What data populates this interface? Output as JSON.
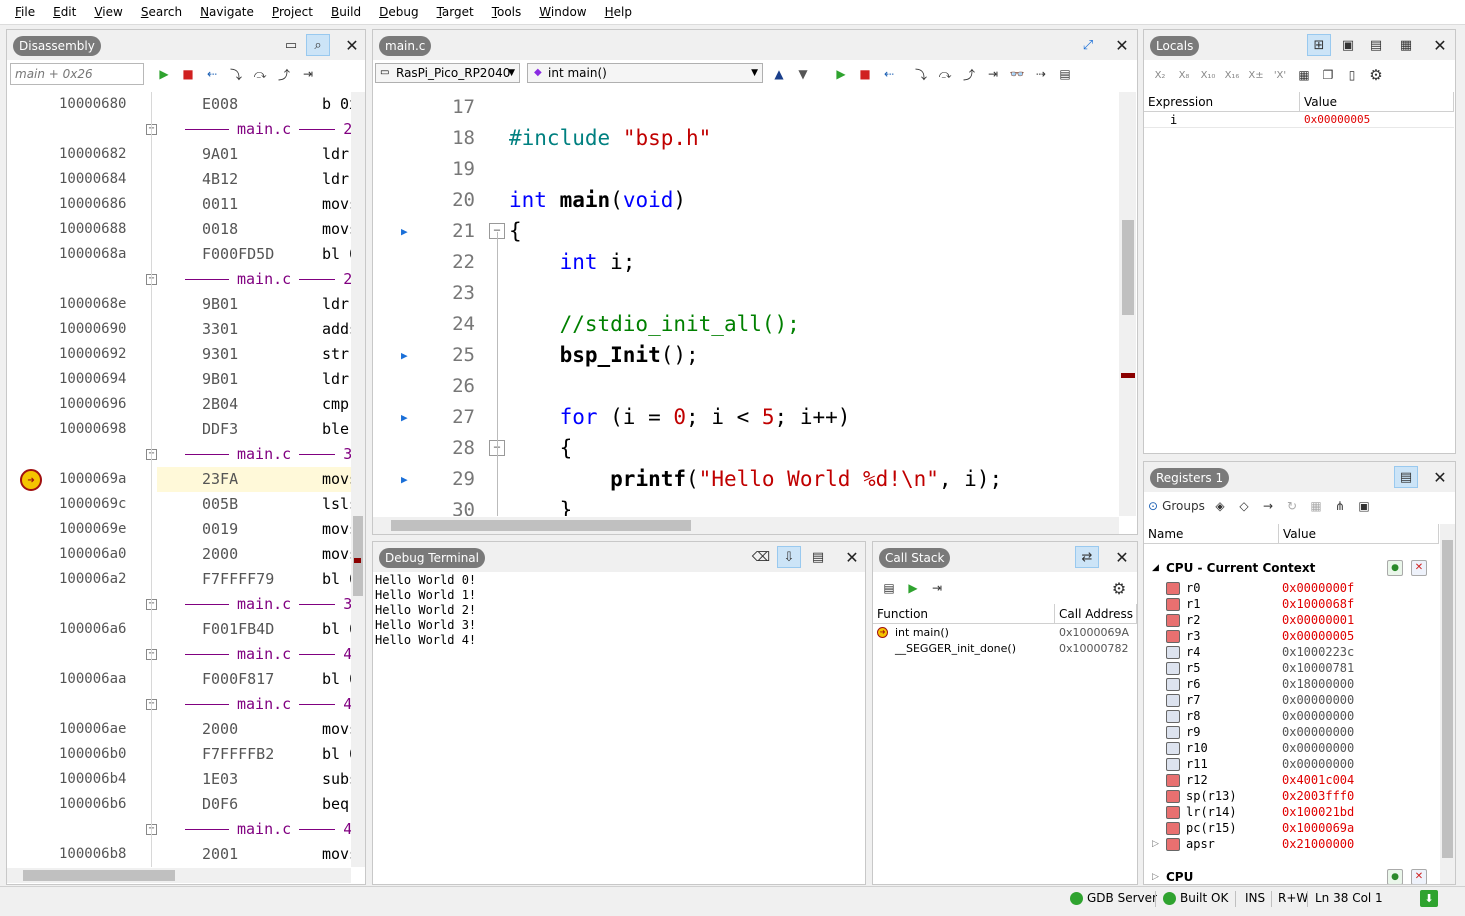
{
  "menu": [
    "File",
    "Edit",
    "View",
    "Search",
    "Navigate",
    "Project",
    "Build",
    "Debug",
    "Target",
    "Tools",
    "Window",
    "Help"
  ],
  "disassembly": {
    "title": "Disassembly",
    "address_input": "main + 0x26",
    "rows": [
      {
        "type": "ins",
        "addr": "10000680",
        "code": "E008",
        "ins": "b 0x"
      },
      {
        "type": "src",
        "text": "main.c",
        "num": "2"
      },
      {
        "type": "ins",
        "addr": "10000682",
        "code": "9A01",
        "ins": "ldr"
      },
      {
        "type": "ins",
        "addr": "10000684",
        "code": "4B12",
        "ins": "ldr"
      },
      {
        "type": "ins",
        "addr": "10000686",
        "code": "0011",
        "ins": "movs"
      },
      {
        "type": "ins",
        "addr": "10000688",
        "code": "0018",
        "ins": "movs"
      },
      {
        "type": "ins",
        "addr": "1000068a",
        "code": "F000FD5D",
        "ins": "bl 0"
      },
      {
        "type": "src",
        "text": "main.c",
        "num": "2"
      },
      {
        "type": "ins",
        "addr": "1000068e",
        "code": "9B01",
        "ins": "ldr"
      },
      {
        "type": "ins",
        "addr": "10000690",
        "code": "3301",
        "ins": "adds"
      },
      {
        "type": "ins",
        "addr": "10000692",
        "code": "9301",
        "ins": "str"
      },
      {
        "type": "ins",
        "addr": "10000694",
        "code": "9B01",
        "ins": "ldr"
      },
      {
        "type": "ins",
        "addr": "10000696",
        "code": "2B04",
        "ins": "cmp"
      },
      {
        "type": "ins",
        "addr": "10000698",
        "code": "DDF3",
        "ins": "ble"
      },
      {
        "type": "src",
        "text": "main.c",
        "num": "3"
      },
      {
        "type": "ins",
        "addr": "1000069a",
        "code": "23FA",
        "ins": "movs",
        "current": true
      },
      {
        "type": "ins",
        "addr": "1000069c",
        "code": "005B",
        "ins": "lsls"
      },
      {
        "type": "ins",
        "addr": "1000069e",
        "code": "0019",
        "ins": "movs"
      },
      {
        "type": "ins",
        "addr": "100006a0",
        "code": "2000",
        "ins": "movs"
      },
      {
        "type": "ins",
        "addr": "100006a2",
        "code": "F7FFFF79",
        "ins": "bl 0"
      },
      {
        "type": "src",
        "text": "main.c",
        "num": "3"
      },
      {
        "type": "ins",
        "addr": "100006a6",
        "code": "F001FB4D",
        "ins": "bl 0"
      },
      {
        "type": "src",
        "text": "main.c",
        "num": "4"
      },
      {
        "type": "ins",
        "addr": "100006aa",
        "code": "F000F817",
        "ins": "bl 0"
      },
      {
        "type": "src",
        "text": "main.c",
        "num": "4"
      },
      {
        "type": "ins",
        "addr": "100006ae",
        "code": "2000",
        "ins": "movs"
      },
      {
        "type": "ins",
        "addr": "100006b0",
        "code": "F7FFFFB2",
        "ins": "bl 0"
      },
      {
        "type": "ins",
        "addr": "100006b4",
        "code": "1E03",
        "ins": "subs"
      },
      {
        "type": "ins",
        "addr": "100006b6",
        "code": "D0F6",
        "ins": "beq"
      },
      {
        "type": "src",
        "text": "main.c",
        "num": "4"
      },
      {
        "type": "ins",
        "addr": "100006b8",
        "code": "2001",
        "ins": "movs"
      }
    ]
  },
  "editor": {
    "tab": "main.c",
    "target_combo": "RasPi_Pico_RP2040",
    "function_combo": "int main()",
    "lines": [
      {
        "n": "17",
        "bp": false,
        "fold": false
      },
      {
        "n": "18",
        "bp": false,
        "fold": false
      },
      {
        "n": "19",
        "bp": false,
        "fold": false
      },
      {
        "n": "20",
        "bp": false,
        "fold": false
      },
      {
        "n": "21",
        "bp": true,
        "fold": true
      },
      {
        "n": "22",
        "bp": false,
        "fold": false
      },
      {
        "n": "23",
        "bp": false,
        "fold": false
      },
      {
        "n": "24",
        "bp": false,
        "fold": false
      },
      {
        "n": "25",
        "bp": true,
        "fold": false
      },
      {
        "n": "26",
        "bp": false,
        "fold": false
      },
      {
        "n": "27",
        "bp": true,
        "fold": false
      },
      {
        "n": "28",
        "bp": false,
        "fold": true
      },
      {
        "n": "29",
        "bp": true,
        "fold": false
      },
      {
        "n": "30",
        "bp": false,
        "fold": false
      }
    ],
    "code": {
      "l18_pp": "#include",
      "l18_str": "\"bsp.h\"",
      "l20_kw1": "int",
      "l20_fn": "main",
      "l20_p1": "(",
      "l20_kw2": "void",
      "l20_p2": ")",
      "l21": "{",
      "l22_kw": "int",
      "l22_rest": " i;",
      "l24": "//stdio_init_all();",
      "l25_fn": "bsp_Init",
      "l25_rest": "();",
      "l27_kw": "for",
      "l27_a": " (i = ",
      "l27_n1": "0",
      "l27_b": "; i < ",
      "l27_n2": "5",
      "l27_c": "; i++)",
      "l28": "{",
      "l29_fn": "printf",
      "l29_a": "(",
      "l29_str": "\"Hello World %d!\\n\"",
      "l29_b": ", i);",
      "l30": "}"
    }
  },
  "terminal": {
    "title": "Debug Terminal",
    "lines": [
      "Hello World 0!",
      "Hello World 1!",
      "Hello World 2!",
      "Hello World 3!",
      "Hello World 4!"
    ]
  },
  "callstack": {
    "title": "Call Stack",
    "col_function": "Function",
    "col_address": "Call Address",
    "rows": [
      {
        "fn": "int main()",
        "addr": "0x1000069A"
      },
      {
        "fn": "__SEGGER_init_done()",
        "addr": "0x10000782"
      }
    ]
  },
  "locals": {
    "title": "Locals",
    "col_expr": "Expression",
    "col_value": "Value",
    "rows": [
      {
        "name": "i",
        "value": "0x00000005"
      }
    ],
    "toolbar": [
      "X2",
      "X8",
      "X10",
      "X16",
      "X10",
      "X"
    ]
  },
  "registers": {
    "title": "Registers 1",
    "groups_label": "Groups",
    "col_name": "Name",
    "col_value": "Value",
    "group_title": "CPU - Current Context",
    "group2_title": "CPU",
    "rows": [
      {
        "name": "r0",
        "value": "0x0000000f",
        "changed": true
      },
      {
        "name": "r1",
        "value": "0x1000068f",
        "changed": true
      },
      {
        "name": "r2",
        "value": "0x00000001",
        "changed": true
      },
      {
        "name": "r3",
        "value": "0x00000005",
        "changed": true
      },
      {
        "name": "r4",
        "value": "0x1000223c",
        "changed": false
      },
      {
        "name": "r5",
        "value": "0x10000781",
        "changed": false
      },
      {
        "name": "r6",
        "value": "0x18000000",
        "changed": false
      },
      {
        "name": "r7",
        "value": "0x00000000",
        "changed": false
      },
      {
        "name": "r8",
        "value": "0x00000000",
        "changed": false
      },
      {
        "name": "r9",
        "value": "0x00000000",
        "changed": false
      },
      {
        "name": "r10",
        "value": "0x00000000",
        "changed": false
      },
      {
        "name": "r11",
        "value": "0x00000000",
        "changed": false
      },
      {
        "name": "r12",
        "value": "0x4001c004",
        "changed": true
      },
      {
        "name": "sp(r13)",
        "value": "0x2003fff0",
        "changed": true
      },
      {
        "name": "lr(r14)",
        "value": "0x100021bd",
        "changed": true
      },
      {
        "name": "pc(r15)",
        "value": "0x1000069a",
        "changed": true
      },
      {
        "name": "apsr",
        "value": "0x21000000",
        "changed": true
      }
    ]
  },
  "status": {
    "gdb": "GDB Server",
    "build": "Built OK",
    "ins": "INS",
    "rw": "R+W",
    "pos": "Ln 38 Col 1"
  },
  "colors": {
    "changed": "#e00000",
    "keyword": "#0000ff",
    "string": "#c00000",
    "comment": "#008000",
    "preprocessor": "#008080",
    "source_line": "#800080",
    "accent": "#1a6fd8"
  }
}
